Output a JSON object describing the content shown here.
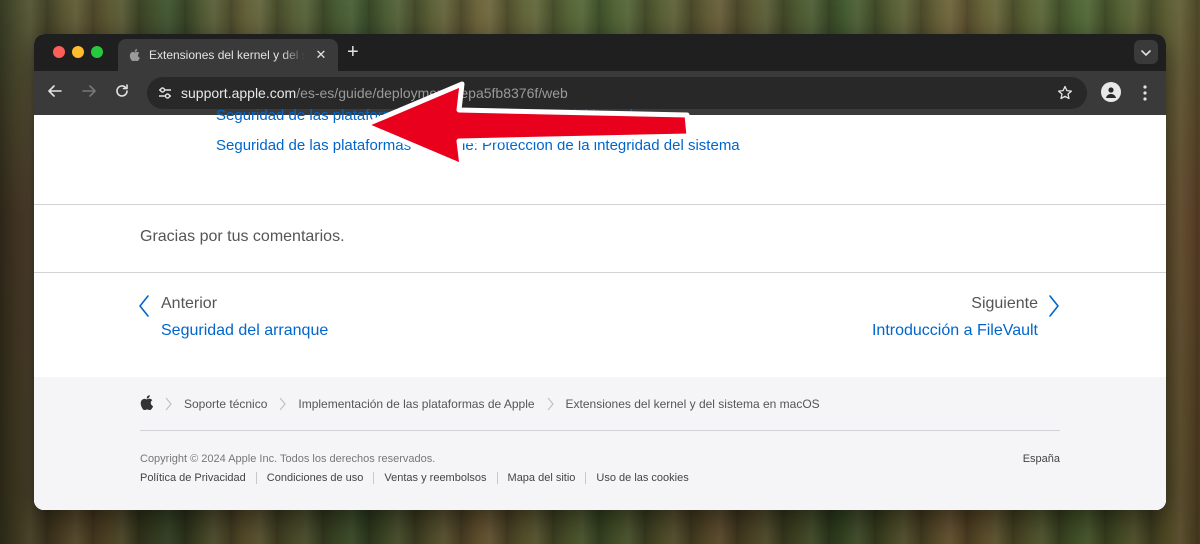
{
  "browser": {
    "tab_title": "Extensiones del kernel y del sistema en macOS",
    "new_tab_label": "+",
    "close_label": "✕",
    "url_host": "support.apple.com",
    "url_path": "/es-es/guide/deployment/depa5fb8376f/web"
  },
  "content": {
    "related_links": [
      "Seguridad de las plataformas de Apple: Extensiones del kernel",
      "Seguridad de las plataformas de Apple: Protección de la integridad del sistema"
    ],
    "feedback_message": "Gracias por tus comentarios.",
    "previous": {
      "label": "Anterior",
      "link": "Seguridad del arranque"
    },
    "next": {
      "label": "Siguiente",
      "link": "Introducción a FileVault"
    }
  },
  "footer": {
    "breadcrumbs": [
      "Soporte técnico",
      "Implementación de las plataformas de Apple",
      "Extensiones del kernel y del sistema en macOS"
    ],
    "copyright": "Copyright © 2024 Apple Inc. Todos los derechos reservados.",
    "country": "España",
    "legal_links": [
      "Política de Privacidad",
      "Condiciones de uso",
      "Ventas y reembolsos",
      "Mapa del sitio",
      "Uso de las cookies"
    ]
  },
  "colors": {
    "link": "#0066cc",
    "annotation_arrow": "#e8001c",
    "browser_chrome": "#3a3a3a"
  },
  "icons": [
    "apple-logo-icon",
    "close-icon",
    "plus-icon",
    "chevron-down-icon",
    "back-arrow-icon",
    "forward-arrow-icon",
    "reload-icon",
    "site-info-icon",
    "star-icon",
    "profile-icon",
    "kebab-menu-icon",
    "chevron-left-icon",
    "chevron-right-icon",
    "breadcrumb-chevron-icon"
  ]
}
